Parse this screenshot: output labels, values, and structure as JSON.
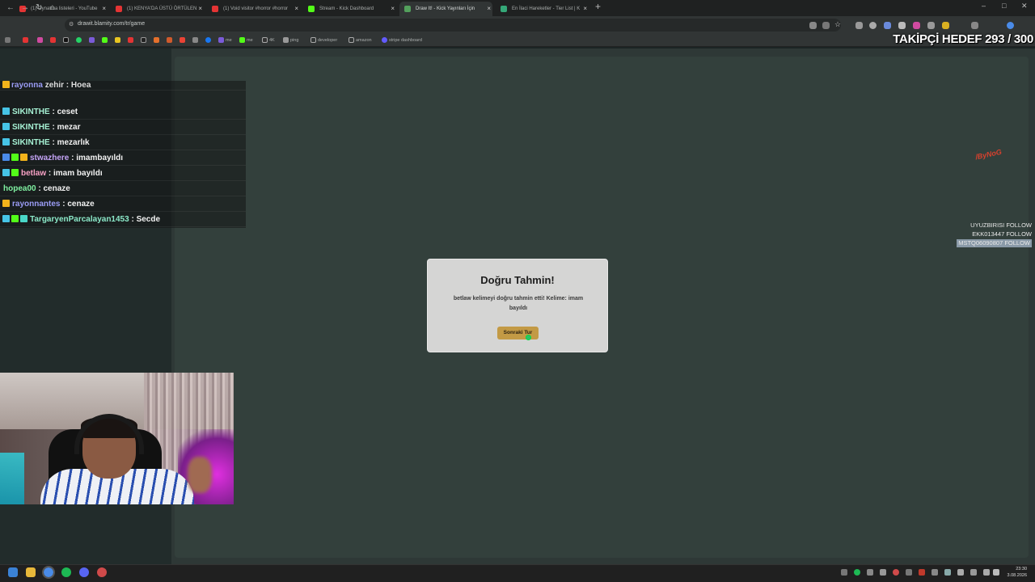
{
  "tabs": [
    {
      "title": "(1) Oynatma listeleri - YouTube",
      "color": "#e43434",
      "active": false
    },
    {
      "title": "(1) KENYA'DA ÜSTÜ ÖRTÜLEN",
      "color": "#e43434",
      "active": false
    },
    {
      "title": "(1) Void visitor #horror #horror",
      "color": "#e43434",
      "active": false
    },
    {
      "title": "Stream - Kick Dashboard",
      "color": "#53fc18",
      "active": false
    },
    {
      "title": "Draw It! - Kick Yayınları İçin",
      "color": "#53a05c",
      "active": true
    },
    {
      "title": "En İlaci Hareketler - Tier List | K",
      "color": "#35a878",
      "active": false
    }
  ],
  "new_tab_label": "+",
  "window_controls": {
    "minimize": "–",
    "maximize": "□",
    "close": "✕"
  },
  "address_bar": {
    "url": "drawit.blamity.com/tr/game"
  },
  "bookmarks": [
    "me",
    "me",
    "4K",
    "ping",
    "developer",
    "amazon",
    "stripe dashboard"
  ],
  "overlay": {
    "follower_goal": "TAKİPÇİ HEDEF 293 / 300",
    "logo_text": "/ByNoG"
  },
  "chat": [
    {
      "user": "SIKINTHE",
      "user_color": "#a6f1d4",
      "message": "ceset",
      "badges": [
        "#46c4e6"
      ]
    },
    {
      "user": "SIKINTHE",
      "user_color": "#a6f1d4",
      "message": "mezar",
      "badges": [
        "#46c4e6"
      ]
    },
    {
      "user": "SIKINTHE",
      "user_color": "#a6f1d4",
      "message": "mezarlık",
      "badges": [
        "#46c4e6"
      ]
    },
    {
      "user": "stwazhere",
      "user_color": "#c3a3f5",
      "message": "imambayıldı",
      "badges": [
        "#4a8be8",
        "#53fc18",
        "#f2b31b"
      ]
    },
    {
      "user": "betlaw",
      "user_color": "#f7a1c4",
      "message": "imam bayıldı",
      "badges": [
        "#46c4e6",
        "#53fc18"
      ]
    },
    {
      "user": "hopea00",
      "user_color": "#7ff0a1",
      "message": "cenaze",
      "badges": []
    },
    {
      "user": "rayonnantes",
      "user_color": "#9a9cf5",
      "message": "cenaze",
      "badges": [
        "#f2b31b"
      ]
    },
    {
      "user": "TargaryenParcalayan1453",
      "user_color": "#8be8c8",
      "message": "Secde",
      "badges": [
        "#46c4e6",
        "#53fc18",
        "#4ad7c8"
      ]
    }
  ],
  "chat_partial_top": {
    "user": "rayonna",
    "message": "zehir",
    "garbled": "Hoea"
  },
  "follow_alerts": [
    "UYUZBIRISI FOLLOW",
    "EKK013447 FOLLOW",
    "MSTQ06090807 FOLLOW"
  ],
  "modal": {
    "title": "Doğru Tahmin!",
    "message": "betlaw kelimeyi doğru tahmin etti! Kelime: imam bayıldı",
    "button_label": "Sonraki Tur"
  },
  "clock": {
    "time": "23:30",
    "date": "3.08.2026"
  }
}
